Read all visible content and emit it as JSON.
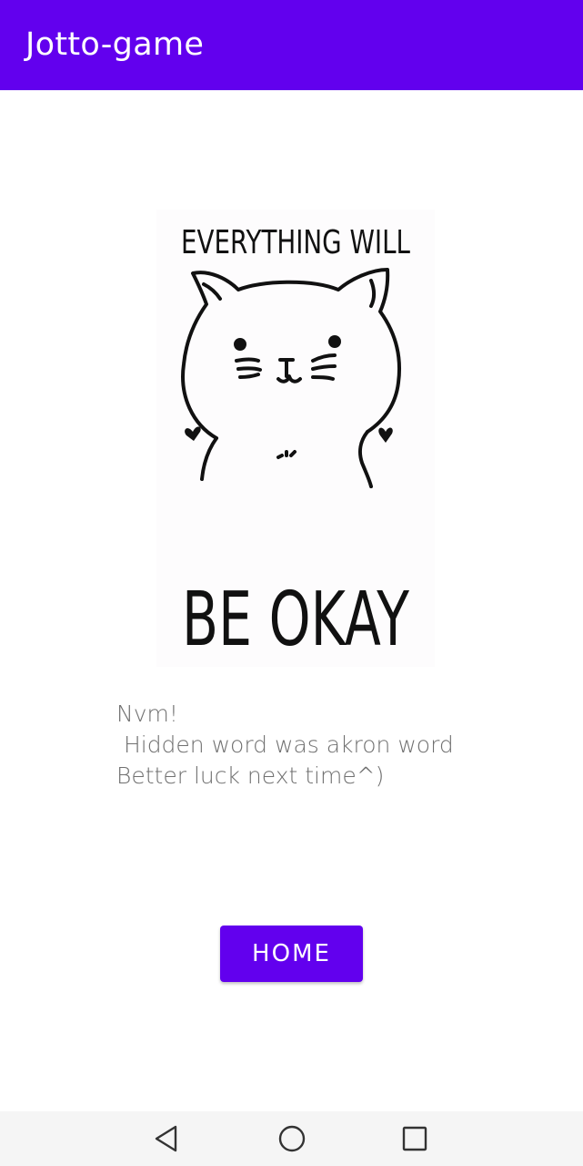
{
  "app_bar": {
    "title": "Jotto-game",
    "color": "#6200ee"
  },
  "poster": {
    "line_top": "EVERYTHING WILL",
    "line_bottom": "BE OKAY",
    "illustration": "cat-face"
  },
  "message": {
    "text": "Nvm!\n Hidden word was akron word\nBetter luck next time^)"
  },
  "home_button": {
    "label": "HOME",
    "color": "#6200ee"
  },
  "nav_bar": {
    "back_icon": "triangle-back-icon",
    "home_icon": "circle-home-icon",
    "recents_icon": "square-recents-icon"
  }
}
